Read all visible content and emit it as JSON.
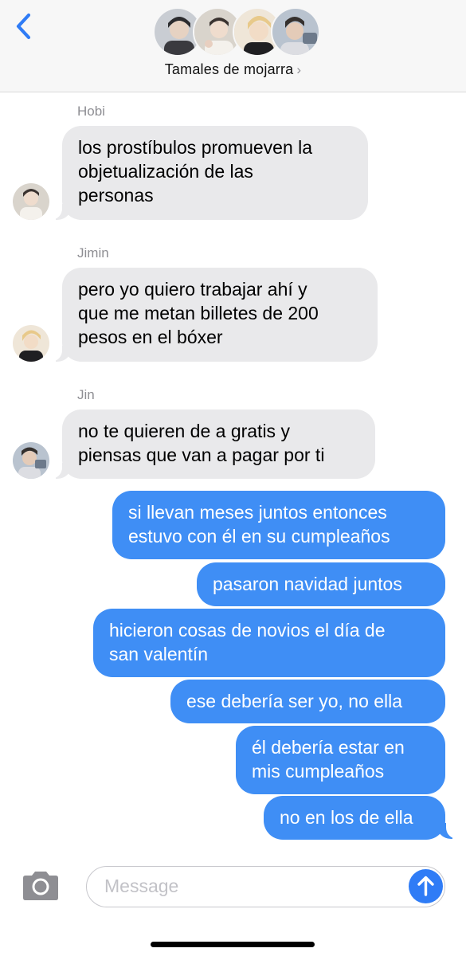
{
  "header": {
    "back_icon": "chevron-left-icon",
    "title": "Tamales de mojarra",
    "title_chevron": "›",
    "avatars": [
      "avatar-1",
      "avatar-2",
      "avatar-3",
      "avatar-4"
    ]
  },
  "messages": [
    {
      "sender": "Hobi",
      "direction": "incoming",
      "text": "los prostíbulos promueven la\nobjetualización de las\npersonas"
    },
    {
      "sender": "Jimin",
      "direction": "incoming",
      "text": "pero yo quiero trabajar ahí y\nque me metan billetes de 200\npesos en el bóxer"
    },
    {
      "sender": "Jin",
      "direction": "incoming",
      "text": "no te quieren de a gratis y\npiensas que van a pagar por ti"
    },
    {
      "direction": "outgoing",
      "text": "si llevan meses juntos entonces\nestuvo con él en su cumpleaños"
    },
    {
      "direction": "outgoing",
      "text": "pasaron navidad juntos"
    },
    {
      "direction": "outgoing",
      "text": "hicieron cosas de novios el día de\nsan valentín"
    },
    {
      "direction": "outgoing",
      "text": "ese debería ser yo, no ella"
    },
    {
      "direction": "outgoing",
      "text": "él debería estar en\nmis cumpleaños"
    },
    {
      "direction": "outgoing",
      "text": "no en los de ella"
    }
  ],
  "composer": {
    "placeholder": "Message",
    "camera_icon": "camera-icon",
    "send_icon": "arrow-up-icon"
  },
  "colors": {
    "accent": "#2f7cf6",
    "outgoing_bubble": "#3f8ef5",
    "incoming_bubble": "#e9e9eb",
    "header_bg": "#f7f7f7"
  }
}
